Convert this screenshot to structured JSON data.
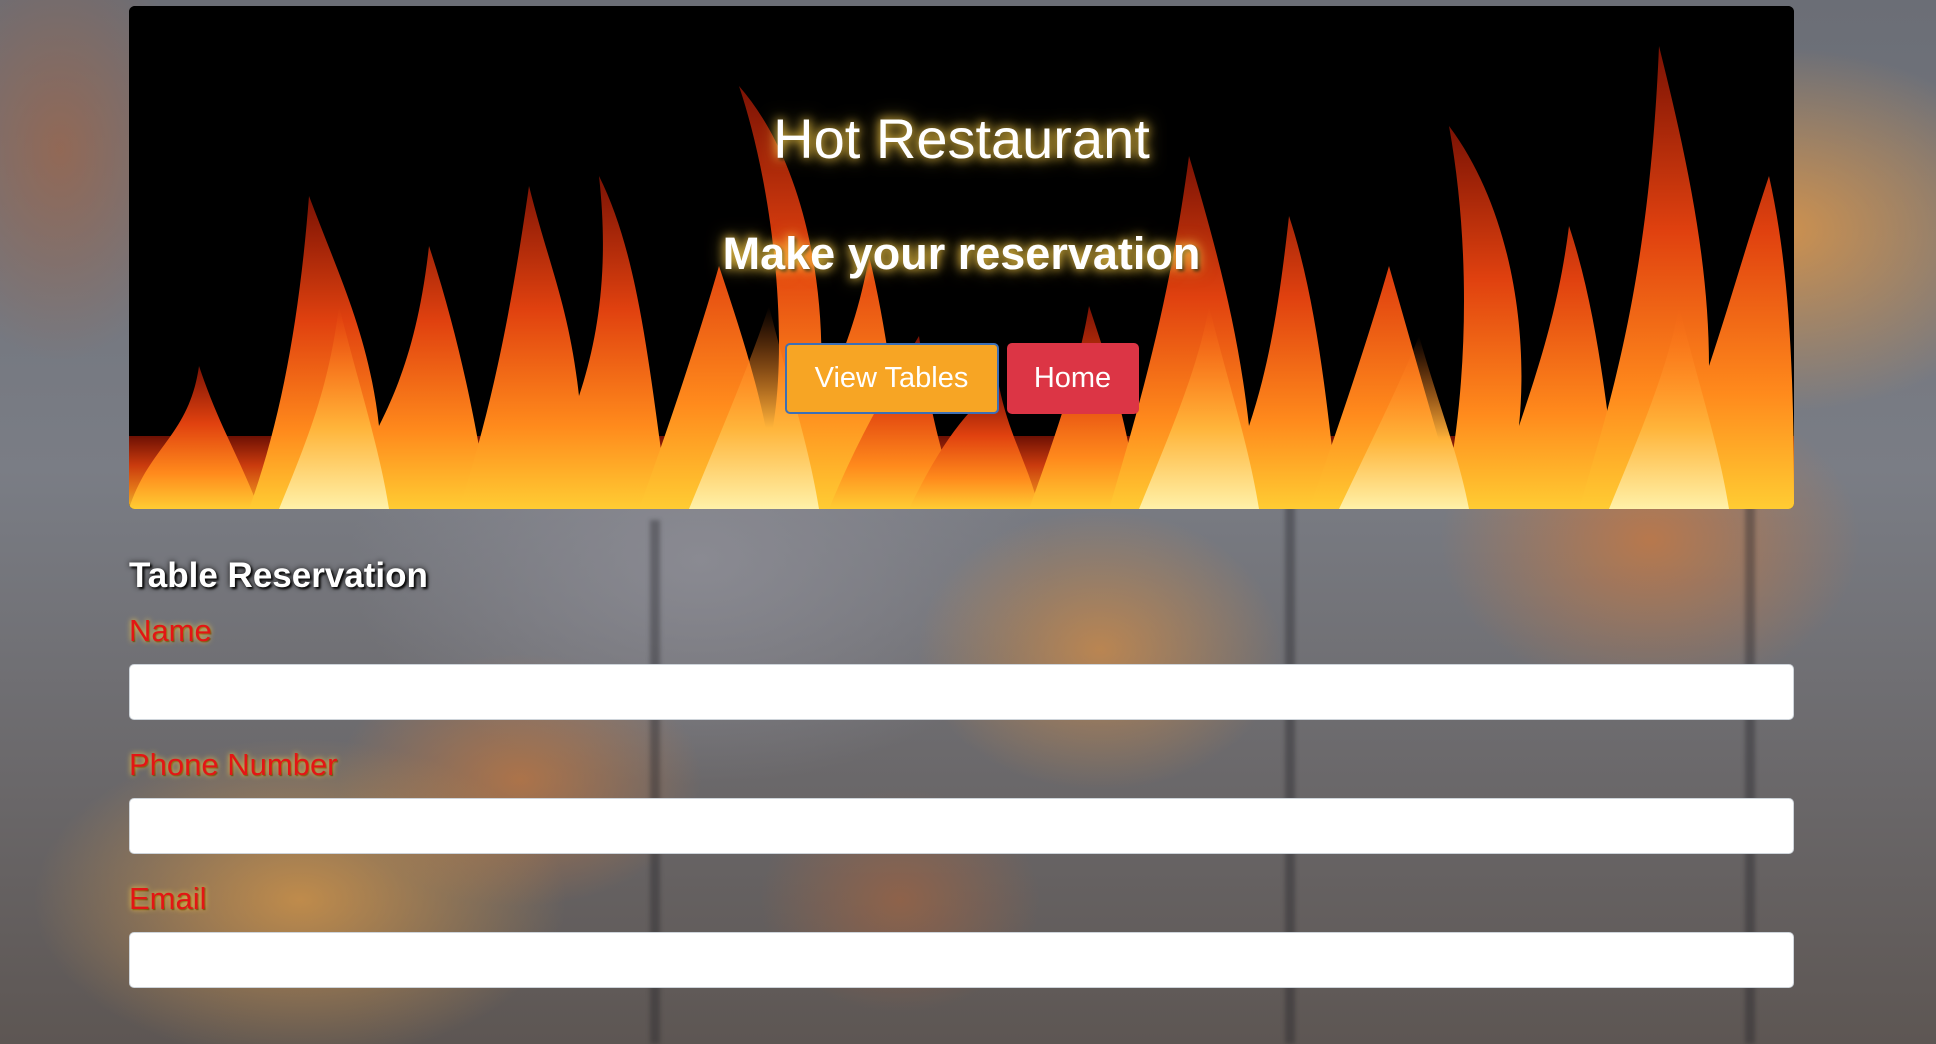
{
  "header": {
    "title": "Hot Restaurant",
    "subtitle": "Make your reservation",
    "view_tables_label": "View Tables",
    "home_label": "Home"
  },
  "form": {
    "heading": "Table Reservation",
    "fields": [
      {
        "label": "Name",
        "value": ""
      },
      {
        "label": "Phone Number",
        "value": ""
      },
      {
        "label": "Email",
        "value": ""
      }
    ]
  },
  "colors": {
    "view_tables_bg": "#f7a524",
    "home_bg": "#dc3545",
    "label_color": "#e31515",
    "title_glow": "#ffd24a"
  }
}
